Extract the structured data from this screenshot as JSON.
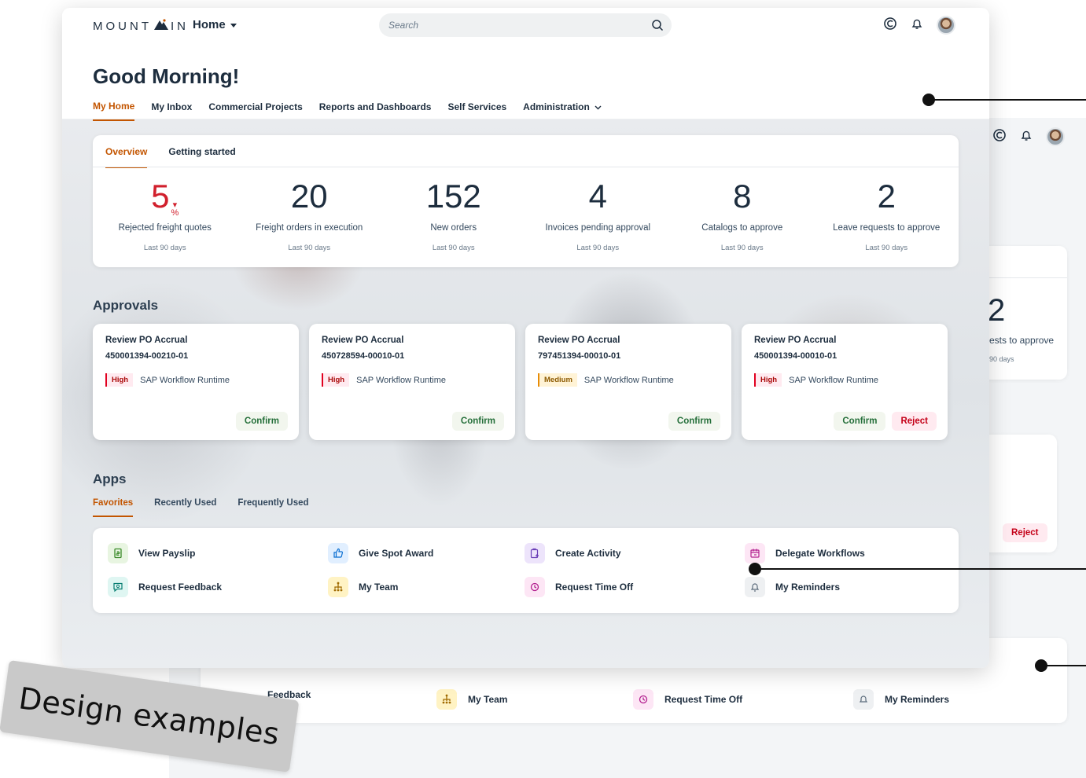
{
  "shell": {
    "logo_left": "MOUNT",
    "logo_right": "IN",
    "home_menu": "Home",
    "search_placeholder": "Search"
  },
  "greeting": "Good Morning!",
  "nav": {
    "items": [
      "My Home",
      "My Inbox",
      "Commercial Projects",
      "Reports and Dashboards",
      "Self Services",
      "Administration"
    ]
  },
  "overview": {
    "tabs": [
      "Overview",
      "Getting started"
    ],
    "kpis": [
      {
        "value": "5",
        "unit": "%",
        "label": "Rejected freight quotes",
        "period": "Last 90 days"
      },
      {
        "value": "20",
        "label": "Freight orders in execution",
        "period": "Last 90 days"
      },
      {
        "value": "152",
        "label": "New orders",
        "period": "Last 90 days"
      },
      {
        "value": "4",
        "label": "Invoices pending approval",
        "period": "Last 90 days"
      },
      {
        "value": "8",
        "label": "Catalogs to approve",
        "period": "Last 90 days"
      },
      {
        "value": "2",
        "label": "Leave requests to approve",
        "period": "Last 90 days"
      }
    ]
  },
  "approvals": {
    "title": "Approvals",
    "cards": [
      {
        "title": "Review PO Accrual",
        "id": "450001394-00210-01",
        "priority": "High",
        "source": "SAP Workflow Runtime",
        "confirm": "Confirm"
      },
      {
        "title": "Review PO Accrual",
        "id": "450728594-00010-01",
        "priority": "High",
        "source": "SAP Workflow Runtime",
        "confirm": "Confirm"
      },
      {
        "title": "Review PO Accrual",
        "id": "797451394-00010-01",
        "priority": "Medium",
        "source": "SAP Workflow Runtime",
        "confirm": "Confirm"
      },
      {
        "title": "Review PO Accrual",
        "id": "450001394-00010-01",
        "priority": "High",
        "source": "SAP Workflow Runtime",
        "confirm": "Confirm",
        "reject": "Reject"
      }
    ]
  },
  "apps": {
    "title": "Apps",
    "tabs": [
      "Favorites",
      "Recently Used",
      "Frequently Used"
    ],
    "items": [
      {
        "label": "View Payslip",
        "icon": "payslip-icon"
      },
      {
        "label": "Give Spot Award",
        "icon": "thumbs-up-icon"
      },
      {
        "label": "Create Activity",
        "icon": "clipboard-icon"
      },
      {
        "label": "Delegate Workflows",
        "icon": "calendar-icon"
      },
      {
        "label": "Request Feedback",
        "icon": "feedback-icon"
      },
      {
        "label": "My Team",
        "icon": "org-chart-icon"
      },
      {
        "label": "Request Time Off",
        "icon": "time-off-icon"
      },
      {
        "label": "My Reminders",
        "icon": "bell-icon"
      }
    ]
  },
  "back_screen": {
    "kpi_value": "2",
    "kpi_label": "ests to approve",
    "kpi_period": "90 days",
    "reject": "Reject",
    "apps": [
      "Feedback",
      "My Team",
      "Request Time Off",
      "My Reminders"
    ]
  },
  "stamp": "Design examples",
  "colors": {
    "accent": "#c35500",
    "negative": "#d1202d",
    "confirm": "#256f3a",
    "reject": "#c40018"
  }
}
